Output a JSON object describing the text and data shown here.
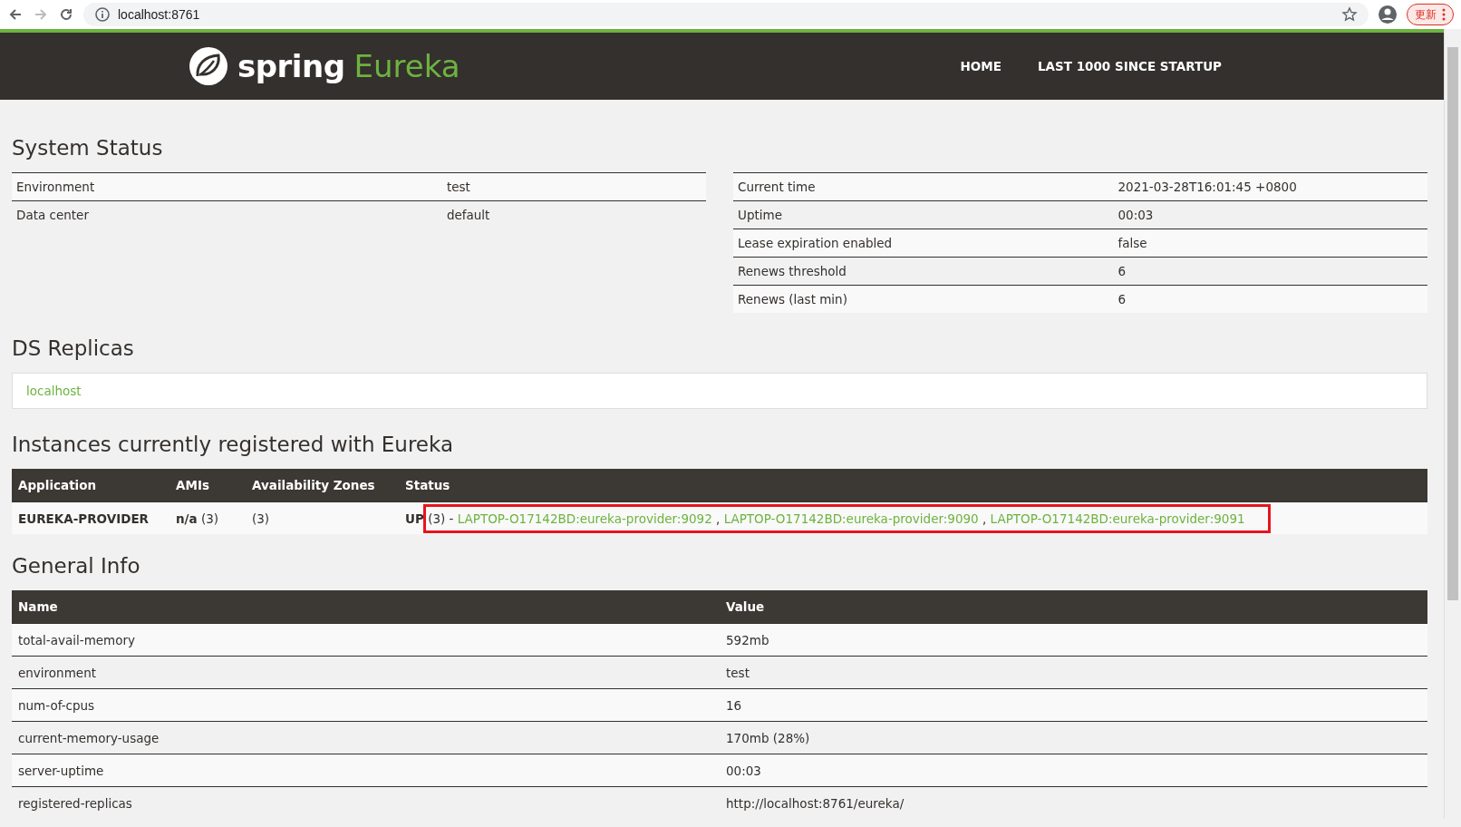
{
  "browser": {
    "url": "localhost:8761",
    "update_label": "更新"
  },
  "header": {
    "brand": "spring",
    "product": "Eureka",
    "nav": [
      {
        "label": "HOME"
      },
      {
        "label": "LAST 1000 SINCE STARTUP"
      }
    ]
  },
  "system_status": {
    "title": "System Status",
    "left": [
      {
        "label": "Environment",
        "value": "test"
      },
      {
        "label": "Data center",
        "value": "default"
      }
    ],
    "right": [
      {
        "label": "Current time",
        "value": "2021-03-28T16:01:45 +0800"
      },
      {
        "label": "Uptime",
        "value": "00:03"
      },
      {
        "label": "Lease expiration enabled",
        "value": "false"
      },
      {
        "label": "Renews threshold",
        "value": "6"
      },
      {
        "label": "Renews (last min)",
        "value": "6"
      }
    ]
  },
  "ds_replicas": {
    "title": "DS Replicas",
    "items": [
      "localhost"
    ]
  },
  "instances": {
    "title": "Instances currently registered with Eureka",
    "columns": [
      "Application",
      "AMIs",
      "Availability Zones",
      "Status"
    ],
    "rows": [
      {
        "application": "EUREKA-PROVIDER",
        "amis": "n/a",
        "ami_count": "(3)",
        "zones": "(3)",
        "status": "UP",
        "status_count": "(3)",
        "separator": "-",
        "link_separator": ",",
        "links": [
          "LAPTOP-O17142BD:eureka-provider:9092",
          "LAPTOP-O17142BD:eureka-provider:9090",
          "LAPTOP-O17142BD:eureka-provider:9091"
        ],
        "highlighted": true
      }
    ]
  },
  "general_info": {
    "title": "General Info",
    "columns": [
      "Name",
      "Value"
    ],
    "rows": [
      {
        "name": "total-avail-memory",
        "value": "592mb"
      },
      {
        "name": "environment",
        "value": "test"
      },
      {
        "name": "num-of-cpus",
        "value": "16"
      },
      {
        "name": "current-memory-usage",
        "value": "170mb (28%)"
      },
      {
        "name": "server-uptime",
        "value": "00:03"
      },
      {
        "name": "registered-replicas",
        "value": "http://localhost:8761/eureka/"
      }
    ]
  }
}
